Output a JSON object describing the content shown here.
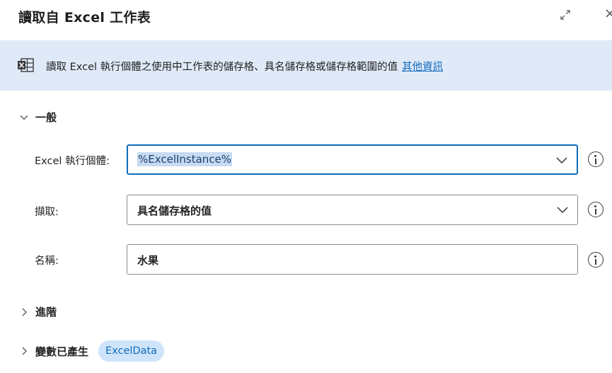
{
  "dialog": {
    "title": "讀取自 Excel 工作表",
    "expand_icon": "expand-icon",
    "close_icon": "close-icon"
  },
  "banner": {
    "icon": "excel-sheet-icon",
    "text": "讀取 Excel 執行個體之使用中工作表的儲存格、具名儲存格或儲存格範圍的值",
    "link": "其他資訊"
  },
  "sections": {
    "general": "一般",
    "advanced": "進階",
    "variables": "變數已產生"
  },
  "fields": {
    "excel_instance": {
      "label": "Excel 執行個體:",
      "value": "%ExcelInstance%"
    },
    "retrieve": {
      "label": "擷取:",
      "value": "具名儲存格的值"
    },
    "name": {
      "label": "名稱:",
      "value": "水果"
    }
  },
  "variables": {
    "chip": "ExcelData"
  },
  "colors": {
    "accent": "#0f6cbd",
    "banner_bg": "#dfe9f7",
    "chip_bg": "#cfe4fa"
  }
}
